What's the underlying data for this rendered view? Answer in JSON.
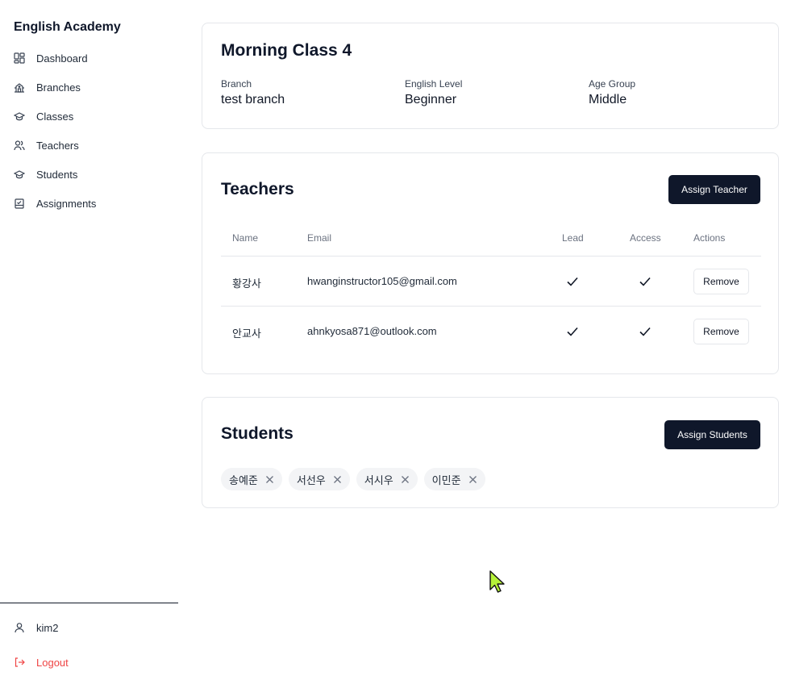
{
  "sidebar": {
    "title": "English Academy",
    "items": [
      {
        "label": "Dashboard",
        "icon": "dashboard-icon"
      },
      {
        "label": "Branches",
        "icon": "building-icon"
      },
      {
        "label": "Classes",
        "icon": "graduation-cap-icon"
      },
      {
        "label": "Teachers",
        "icon": "users-icon"
      },
      {
        "label": "Students",
        "icon": "graduation-cap-icon"
      },
      {
        "label": "Assignments",
        "icon": "clipboard-check-icon"
      }
    ],
    "user": {
      "label": "kim2",
      "icon": "user-icon"
    },
    "logout": {
      "label": "Logout",
      "icon": "logout-icon",
      "color": "#ef4444"
    }
  },
  "class_info": {
    "title": "Morning Class 4",
    "branch_label": "Branch",
    "branch_value": "test branch",
    "level_label": "English Level",
    "level_value": "Beginner",
    "age_label": "Age Group",
    "age_value": "Middle"
  },
  "teachers": {
    "title": "Teachers",
    "assign_button": "Assign Teacher",
    "columns": [
      "Name",
      "Email",
      "Lead",
      "Access",
      "Actions"
    ],
    "rows": [
      {
        "name": "황강사",
        "email": "hwanginstructor105@gmail.com",
        "lead": true,
        "access": true,
        "action": "Remove"
      },
      {
        "name": "안교사",
        "email": "ahnkyosa871@outlook.com",
        "lead": true,
        "access": true,
        "action": "Remove"
      }
    ]
  },
  "students": {
    "title": "Students",
    "assign_button": "Assign Students",
    "list": [
      "송예준",
      "서선우",
      "서시우",
      "이민준"
    ]
  },
  "colors": {
    "accent_dark": "#0f172a",
    "danger": "#ef4444",
    "border": "#e5e7eb",
    "chip_bg": "#f3f4f6"
  }
}
